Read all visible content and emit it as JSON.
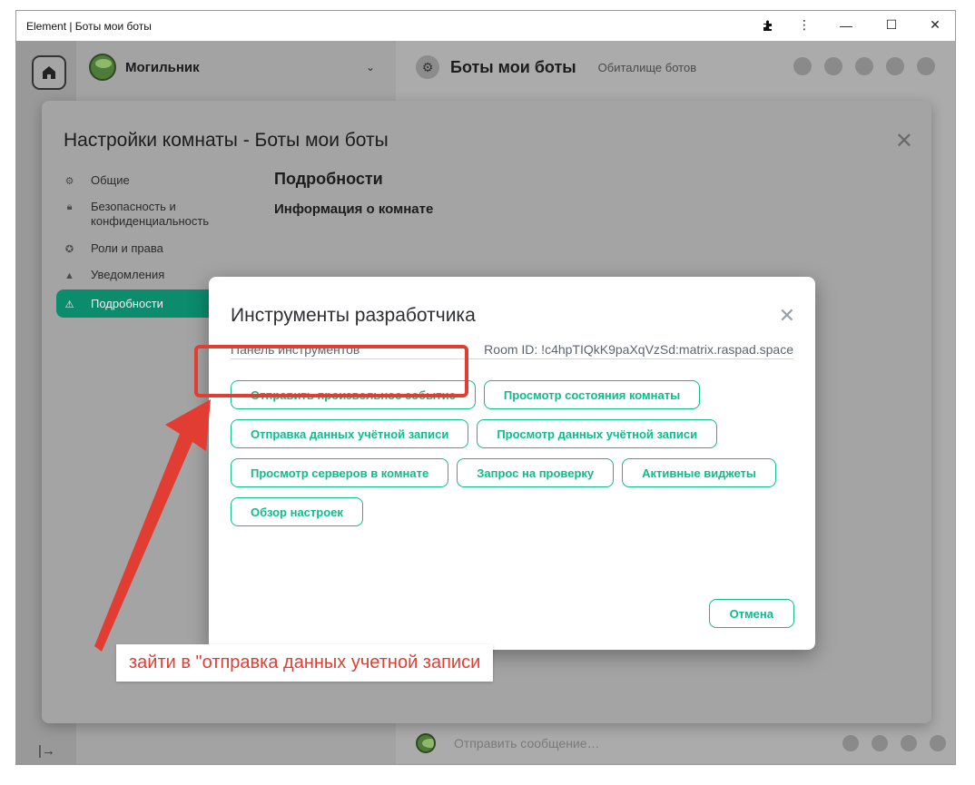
{
  "window": {
    "title": "Element | Боты мои боты",
    "controls": [
      "extensions-icon",
      "more-icon",
      "minimize-icon",
      "maximize-icon",
      "close-icon"
    ]
  },
  "account": {
    "name": "Могильник"
  },
  "room": {
    "name": "Боты мои боты",
    "topic": "Обиталище ботов",
    "composer_placeholder": "Отправить сообщение…"
  },
  "settings": {
    "title": "Настройки комнаты - Боты мои боты",
    "nav": [
      {
        "label": "Общие",
        "icon": "gear-icon"
      },
      {
        "label": "Безопасность и конфиденциальность",
        "icon": "lock-icon"
      },
      {
        "label": "Роли и права",
        "icon": "shield-icon"
      },
      {
        "label": "Уведомления",
        "icon": "bell-icon"
      },
      {
        "label": "Подробности",
        "icon": "warning-icon",
        "active": true
      }
    ],
    "section_title": "Подробности",
    "section_subtitle": "Информация о комнате"
  },
  "devtools": {
    "title": "Инструменты разработчика",
    "panel_label": "Панель инструментов",
    "room_id": "Room ID: !c4hpTIQkK9paXqVzSd:matrix.raspad.space",
    "buttons": [
      "Отправить произвольное событие",
      "Просмотр состояния комнаты",
      "Отправка данных учётной записи",
      "Просмотр данных учётной записи",
      "Просмотр серверов в комнате",
      "Запрос на проверку",
      "Активные виджеты",
      "Обзор настроек"
    ],
    "cancel_label": "Отмена"
  },
  "annotation": {
    "callout_text": "зайти в \"отправка данных учетной записи",
    "color": "#e23d32"
  },
  "colors": {
    "accent": "#0dbd8b",
    "active_nav": "#0b8c6c"
  }
}
